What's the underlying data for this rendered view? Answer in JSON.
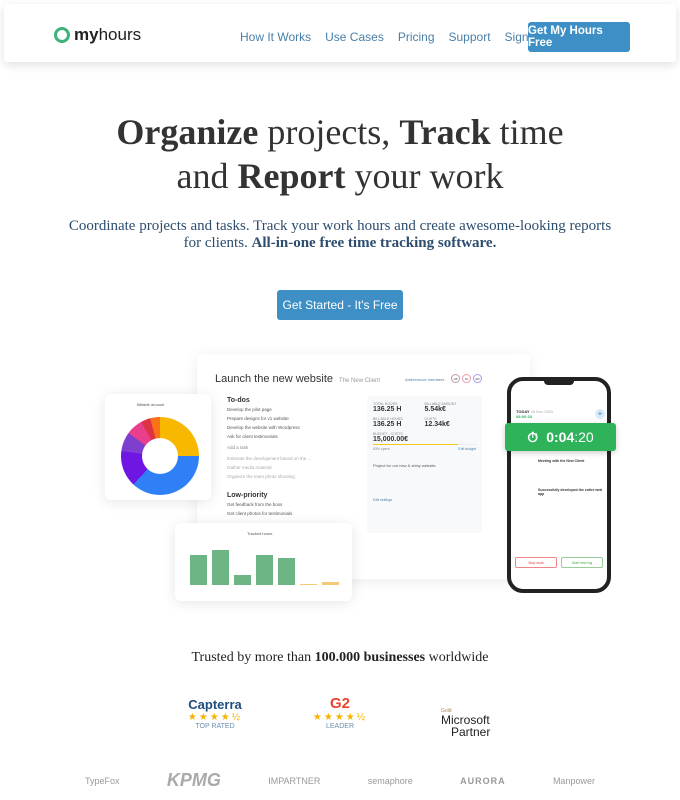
{
  "header": {
    "logo": {
      "bold": "my",
      "rest": "hours"
    },
    "nav": [
      "How It Works",
      "Use Cases",
      "Pricing",
      "Support",
      "Sign in"
    ],
    "cta": "Get My Hours Free",
    "accent": "#3d8fc6"
  },
  "hero": {
    "l1a": "Organize",
    "l1b": " projects, ",
    "l1c": "Track",
    "l1d": " time",
    "l2a": "and ",
    "l2b": "Report",
    "l2c": " your work",
    "sub": "Coordinate projects and tasks. Track your work hours and create awesome-looking reports for clients. ",
    "sub_bold": "All-in-one free time tracking software.",
    "button": "Get Started - It's Free"
  },
  "app": {
    "project": "Launch the new website",
    "client": "The New Client",
    "members": "Add/remove members",
    "avatars": [
      "LB",
      "JC",
      "AD"
    ],
    "todos_title": "To-dos",
    "todos": [
      "Develop the pilot page",
      "Prepare designs for v1 website",
      "Develop the website with Wordpress",
      "Ask for client testimonials"
    ],
    "add_task": "Add a task",
    "done": [
      "Estimate the development based on the ...",
      "Gather media material",
      "Organize the team photo shooting"
    ],
    "low_title": "Low-priority",
    "low": [
      "Get feedback from the boss",
      "Get client photos for testimonials"
    ],
    "stats": [
      {
        "label": "TOTAL HOURS",
        "value": "136.25 H"
      },
      {
        "label": "BILLABLE AMOUNT",
        "value": "5.54k€"
      },
      {
        "label": "BILLABLE HOURS",
        "value": "136.25 H"
      },
      {
        "label": "COSTS",
        "value": "12.34k€"
      }
    ],
    "budget_label": "BUDGET - COSTS",
    "budget": "15,000.00€",
    "spent": "83% spent",
    "spent_pct": 83,
    "edit_budget": "Edit budget",
    "desc": "Project for our new & shiny website.",
    "edit_settings": "Edit settings",
    "donut_label": "Billable amount",
    "bars_label": "Tracked hours",
    "bars": [
      0.72,
      0.84,
      0.24,
      0.71,
      0.64,
      0.03,
      0.08
    ],
    "phone": {
      "today": "TODAY",
      "date": "26 Nov 2020",
      "total": "08:00:23",
      "timer_main": "0:04",
      "timer_sec": ":20",
      "log1": "Meeting with the New Client",
      "log2": "Successfully developed the entire web app",
      "stop": "Stop work",
      "new": "Start new log"
    }
  },
  "social": {
    "trusted_a": "Trusted by more than ",
    "trusted_b": "100.000 businesses",
    "trusted_c": " worldwide",
    "badges": [
      {
        "name": "Capterra",
        "label": "TOP RATED",
        "stars": "★★★★½"
      },
      {
        "name": "G2",
        "label": "LEADER",
        "stars": "★★★★½"
      }
    ],
    "ms_gold": "Gold",
    "ms": "Microsoft",
    "ms2": "Partner",
    "logos": [
      "TypeFox",
      "KPMG",
      "IMPARTNER",
      "semaphore",
      "AURORA",
      "Manpower"
    ]
  }
}
